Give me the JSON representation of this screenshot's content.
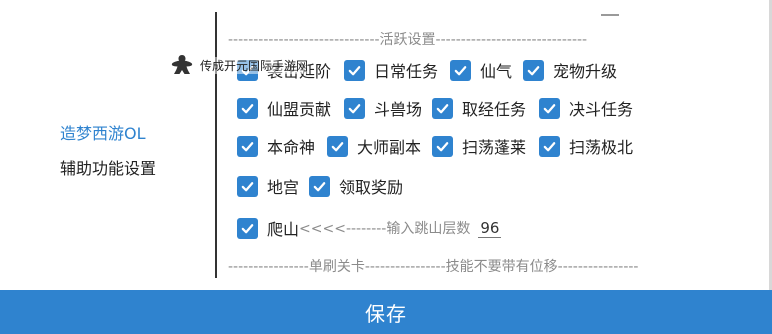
{
  "sidebar": {
    "items": [
      {
        "label": "造梦西游OL",
        "active": true
      },
      {
        "label": "辅助功能设置",
        "active": false
      }
    ]
  },
  "section_header": "------------------------------活跃设置------------------------------",
  "watermark": "传成开元国际手游网",
  "checkboxes": {
    "row1": [
      {
        "label": "袭击延阶",
        "checked": true
      },
      {
        "label": "日常任务",
        "checked": true
      },
      {
        "label": "仙气",
        "checked": true
      },
      {
        "label": "宠物升级",
        "checked": true
      }
    ],
    "row2": [
      {
        "label": "仙盟贡献",
        "checked": true
      },
      {
        "label": "斗兽场",
        "checked": true
      },
      {
        "label": "取经任务",
        "checked": true
      },
      {
        "label": "决斗任务",
        "checked": true
      }
    ],
    "row3": [
      {
        "label": "本命神",
        "checked": true
      },
      {
        "label": "大师副本",
        "checked": true
      },
      {
        "label": "扫荡蓬莱",
        "checked": true
      },
      {
        "label": "扫荡极北",
        "checked": true
      }
    ],
    "row4": [
      {
        "label": "地宫",
        "checked": true
      },
      {
        "label": "领取奖励",
        "checked": true
      }
    ]
  },
  "climb": {
    "label": "爬山",
    "hint": "<<<<--------输入跳山层数",
    "floors": "96",
    "checked": true
  },
  "bottom_separator": "----------------单刷关卡----------------技能不要带有位移----------------",
  "save_button": "保存",
  "colors": {
    "accent": "#2f83cf",
    "muted": "#8b8b8b"
  },
  "icons": {
    "checkbox": "check-icon",
    "watermark": "meeple-icon",
    "window": "minimize-icon"
  }
}
